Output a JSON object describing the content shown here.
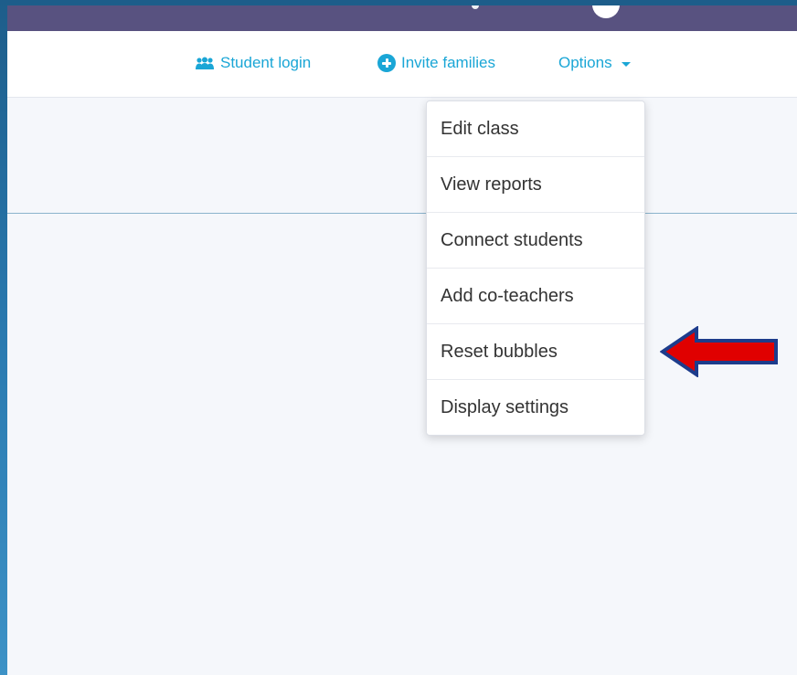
{
  "nav": {
    "student_login": "Student login",
    "invite_families": "Invite families",
    "options": "Options"
  },
  "dropdown": {
    "items": [
      {
        "label": "Edit class"
      },
      {
        "label": "View reports"
      },
      {
        "label": "Connect students"
      },
      {
        "label": "Add co-teachers"
      },
      {
        "label": "Reset bubbles"
      },
      {
        "label": "Display settings"
      }
    ]
  },
  "colors": {
    "accent": "#1aa6d6",
    "topbar": "#585280",
    "arrow": "#e00000",
    "arrow_outline": "#1d3c8c"
  },
  "icons": {
    "student_login": "students-icon",
    "invite_families": "plus-circle-icon",
    "options": "caret-down-icon",
    "pointer": "arrow-left-icon"
  }
}
